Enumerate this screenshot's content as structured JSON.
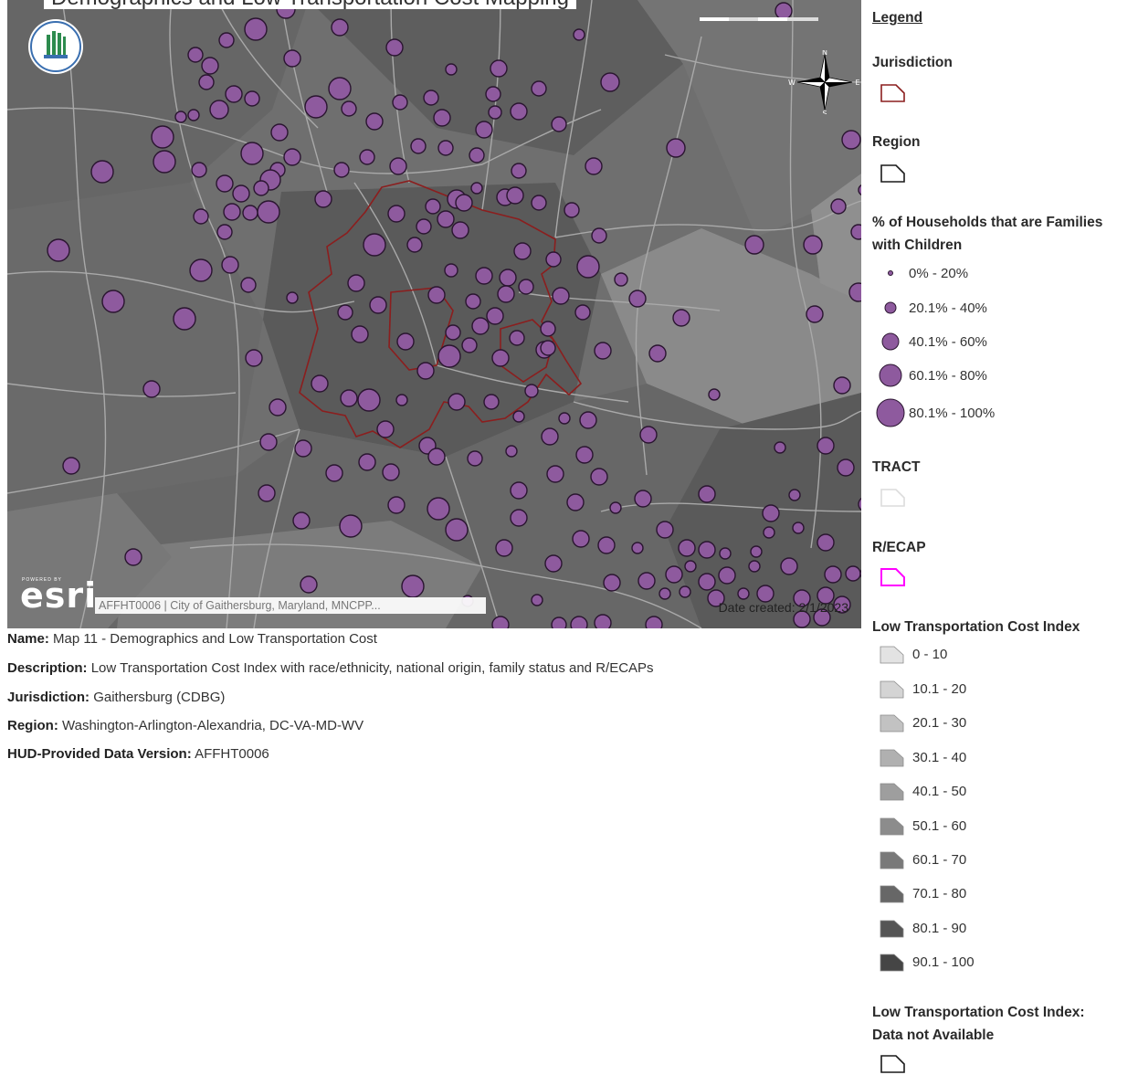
{
  "map": {
    "title": "Demographics and Low Transportation Cost Mapping",
    "attribution": "AFFHT0006 | City of Gaithersburg, Maryland, MNCPP...",
    "date_created": "Date created: 2/1/2023",
    "logo_text": "esri",
    "logo_powered": "POWERED BY",
    "compass": {
      "n": "N",
      "s": "S",
      "e": "E",
      "w": "W"
    },
    "colors": {
      "background": "#6f6f6f",
      "dot_fill": "#8e5a9e",
      "dot_stroke": "#2a1530",
      "jurisdiction": "#8b1e1e",
      "tract_line": "#a9a9a9"
    }
  },
  "metadata": [
    {
      "label": "Name:",
      "value": "Map 11 - Demographics and Low Transportation Cost"
    },
    {
      "label": "Description:",
      "value": "Low Transportation Cost Index with race/ethnicity, national origin, family status and R/ECAPs"
    },
    {
      "label": "Jurisdiction:",
      "value": "Gaithersburg (CDBG)"
    },
    {
      "label": "Region:",
      "value": "Washington-Arlington-Alexandria, DC-VA-MD-WV"
    },
    {
      "label": "HUD-Provided Data Version:",
      "value": "AFFHT0006"
    }
  ],
  "legend": {
    "title": "Legend",
    "jurisdiction": "Jurisdiction",
    "region": "Region",
    "families_title_1": "% of Households that are Families",
    "families_title_2": "with Children",
    "families_classes": [
      "0% - 20%",
      "20.1% - 40%",
      "40.1% - 60%",
      "60.1% - 80%",
      "80.1% - 100%"
    ],
    "tract": "TRACT",
    "recap": "R/ECAP",
    "ltci_title": "Low Transportation Cost Index",
    "ltci_classes": [
      "0 - 10",
      "10.1 - 20",
      "20.1 - 30",
      "30.1 - 40",
      "40.1 - 50",
      "50.1 - 60",
      "60.1 - 70",
      "70.1 - 80",
      "80.1 - 90",
      "90.1 - 100"
    ],
    "ltci_na_1": "Low Transportation Cost Index:",
    "ltci_na_2": "Data not Available"
  }
}
